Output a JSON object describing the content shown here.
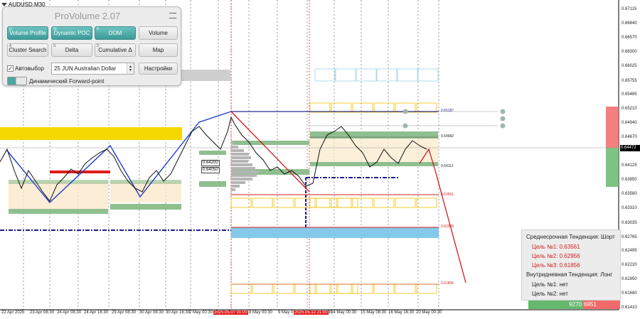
{
  "symbol": "AUDUSD,M30",
  "panel": {
    "title": "ProVolume 2.07",
    "buttons": [
      {
        "label": "Volume Profile",
        "key": "Q",
        "active": true
      },
      {
        "label": "Dynamic POC",
        "key": "W",
        "active": true
      },
      {
        "label": "DOM",
        "key": "E",
        "active": true
      },
      {
        "label": "Volume",
        "key": "",
        "active": false
      },
      {
        "label": "Cluster Search",
        "key": "A",
        "active": false
      },
      {
        "label": "Delta",
        "key": "S",
        "active": false
      },
      {
        "label": "Cumulative Δ",
        "key": "D",
        "active": false
      },
      {
        "label": "Map",
        "key": "",
        "active": false
      }
    ],
    "auto_label": "Автовыбор",
    "auto_checked": "✓",
    "instrument_value": "25 JUN Australian Dollar",
    "settings_label": "Настройки",
    "forward_label": "Динамический Forward-point"
  },
  "y_axis": [
    "0.67115",
    "0.66840",
    "0.66570",
    "0.66300",
    "0.66025",
    "0.65755",
    "0.65485",
    "0.65210",
    "0.64940",
    "0.64670",
    "0.64395",
    "0.64125",
    "0.63850",
    "0.63580",
    "0.63310",
    "0.63035",
    "0.62765",
    "0.62495",
    "0.62220",
    "0.61950",
    "0.61680",
    "0.61410"
  ],
  "current_price": "0.64472",
  "x_axis": [
    {
      "label": "22 Apr 2025",
      "hl": false
    },
    {
      "label": "23 Apr 08:30",
      "hl": false
    },
    {
      "label": "24 Apr 08:30",
      "hl": false
    },
    {
      "label": "24 Apr 16:30",
      "hl": false
    },
    {
      "label": "29 Apr 08:30",
      "hl": false
    },
    {
      "label": "30 Apr 08:30",
      "hl": false
    },
    {
      "label": "30 Apr 16:30",
      "hl": false
    },
    {
      "label": "2 May 00:30",
      "hl": false
    },
    {
      "label": "5 May 08:",
      "hl": false
    },
    {
      "label": "2025.05.07 01:00",
      "hl": true
    },
    {
      "label": "8 May 00:30",
      "hl": false
    },
    {
      "label": "9 May 0",
      "hl": false
    },
    {
      "label": "2025.05.12 21:00",
      "hl": true
    },
    {
      "label": "30",
      "hl": false
    },
    {
      "label": "14 May 00:30",
      "hl": false
    },
    {
      "label": "15 May 08:30",
      "hl": false
    },
    {
      "label": "16 May 16:30",
      "hl": false
    },
    {
      "label": "20 May 00:30",
      "hl": false
    }
  ],
  "levels": {
    "l1": "0.65187",
    "l2": "0.64682",
    "l3": "0.64112",
    "l4": "0.63561",
    "l5": "0.62956",
    "l6": "0.61856",
    "t1": "0.64200",
    "t2": "0.64050"
  },
  "info": {
    "mid_trend": "Среднесрочная Тенденция: Шорт",
    "target1": "Цель №1: 0.63561",
    "target2": "Цель №2: 0.62956",
    "target3": "Цель №3: 0.61856",
    "intraday_trend": "Внутридневная Тенденция: Лонг",
    "itarget1": "Цель №1: нет",
    "itarget2": "Цель №2: нет"
  },
  "volume": {
    "buy": "9270",
    "sell": "6951"
  },
  "colors": {
    "accent": "#4aa7a4",
    "sell": "#e31c1c",
    "buy": "#66b86d",
    "level_zone": "#f5d800",
    "profile_zone": "#85c9ea"
  }
}
